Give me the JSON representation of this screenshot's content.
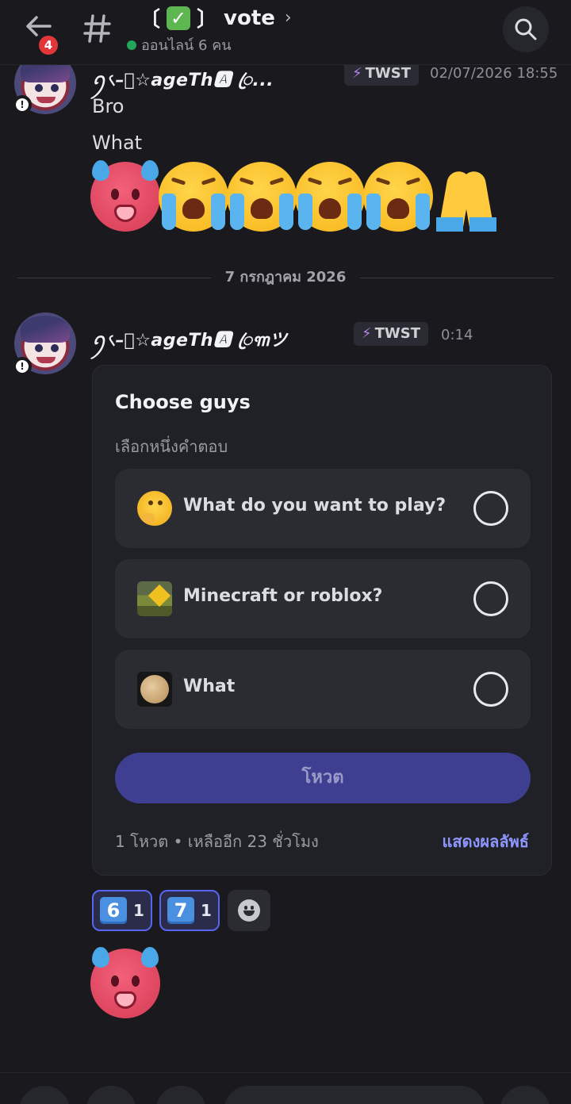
{
  "header": {
    "back_badge": "4",
    "channel_name": "vote",
    "title_chevron": "›",
    "online_status": "ออนไลน์ 6 คน"
  },
  "messages": [
    {
      "username": "ꪆ৻–⃟☆ageTh🅰 ꦿ...",
      "tag": "TWST",
      "timestamp": "02/07/2026 18:55",
      "lines": [
        "Bro",
        "What"
      ],
      "emoji_names": [
        "hot-face-icon",
        "loudly-crying-face-icon",
        "loudly-crying-face-icon",
        "loudly-crying-face-icon",
        "loudly-crying-face-icon",
        "folded-hands-icon"
      ]
    }
  ],
  "date_divider": "7 กรกฎาคม 2026",
  "poll_message": {
    "username": "ꪆ৻–⃟☆ageTh🅰 ꦿ꧑ツ",
    "tag": "TWST",
    "timestamp": "0:14"
  },
  "poll": {
    "question": "Choose guys",
    "hint": "เลือกหนึ่งคำตอบ",
    "options": [
      {
        "label": "What do you want to play?",
        "icon": "thinking-face-icon"
      },
      {
        "label": "Minecraft or roblox?",
        "icon": "minecraft-roblox-image"
      },
      {
        "label": "What",
        "icon": "cookie-image"
      }
    ],
    "vote_button": "โหวต",
    "footer": "1 โหวต • เหลืออีก 23 ชั่วโมง",
    "show_results": "แสดงผลลัพธ์"
  },
  "reactions": [
    {
      "emoji": "6",
      "count": "1"
    },
    {
      "emoji": "7",
      "count": "1"
    }
  ],
  "colors": {
    "background": "#1a1a1e",
    "accent": "#5865f2",
    "vote_button": "#3f3f91",
    "online": "#23a55a",
    "badge": "#e2363b"
  }
}
